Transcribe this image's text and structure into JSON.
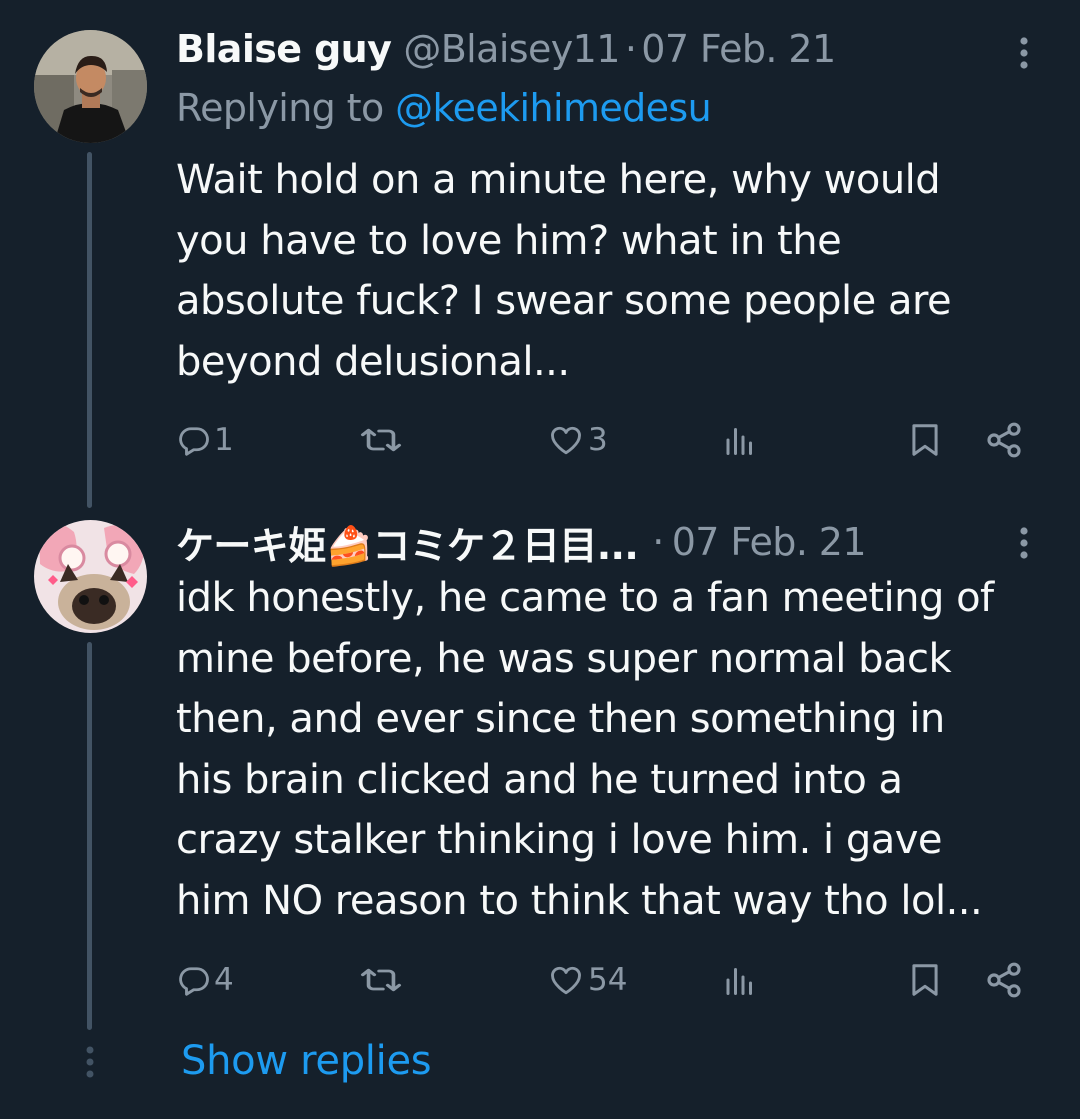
{
  "tweets": [
    {
      "author_name": "Blaise guy",
      "handle": "@Blaisey11",
      "separator": "·",
      "date": "07 Feb. 21",
      "reply_prefix": "Replying to ",
      "reply_mention": "@keekihimedesu",
      "text": "Wait hold on a minute here, why would\nyou have to love him? what in the\nabsolute fuck? I swear some people are\nbeyond delusional...",
      "replies": "1",
      "reposts": "",
      "likes": "3",
      "views": "",
      "icons": [
        "reply-icon",
        "repost-icon",
        "like-icon",
        "views-icon",
        "bookmark-icon",
        "share-icon",
        "more-icon"
      ]
    },
    {
      "author_name": "ケーキ姫🍰コミケ２日目...",
      "separator": "·",
      "date": "07 Feb. 21",
      "text": "idk honestly, he came to a fan meeting of\nmine before, he was super normal back\nthen, and ever since then something in\nhis brain clicked and he turned into a\ncrazy stalker thinking i love him. i gave\nhim NO reason to think that way tho lol...",
      "replies": "4",
      "reposts": "",
      "likes": "54",
      "views": "",
      "icons": [
        "reply-icon",
        "repost-icon",
        "like-icon",
        "views-icon",
        "bookmark-icon",
        "share-icon",
        "more-icon"
      ]
    }
  ],
  "show_replies_label": "Show replies",
  "colors": {
    "background": "#15202b",
    "text": "#f7f9f9",
    "muted": "#8b98a5",
    "accent": "#1d9bf0",
    "thread_line": "#425364"
  }
}
